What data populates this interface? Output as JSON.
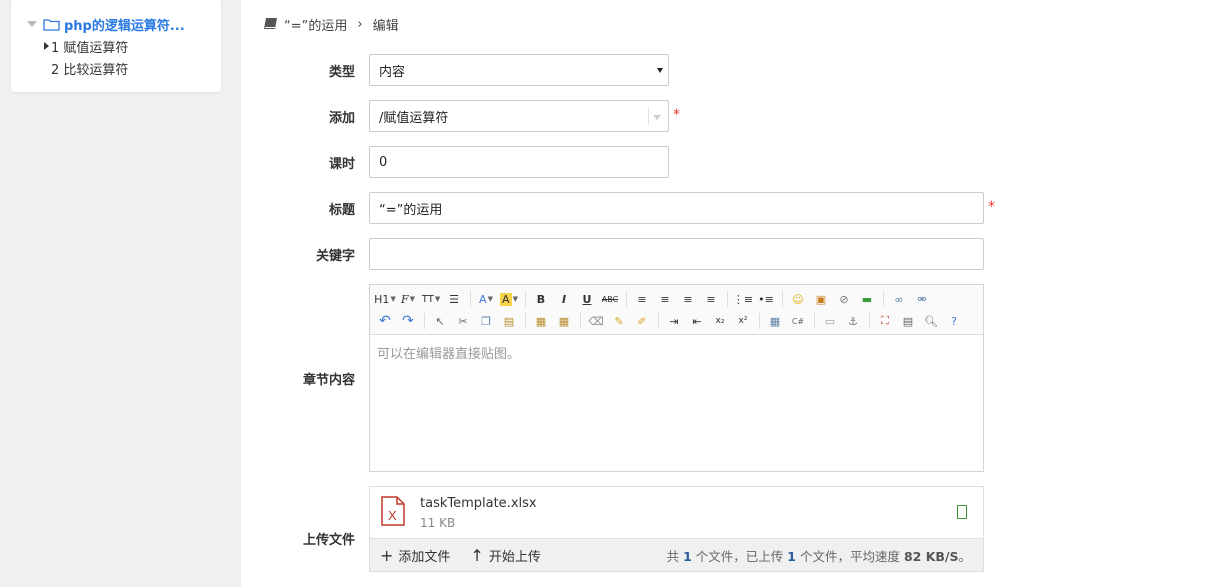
{
  "sidebar": {
    "root_label": "php的逻辑运算符...",
    "children": [
      {
        "label": "1 赋值运算符"
      },
      {
        "label": "2 比较运算符"
      }
    ]
  },
  "breadcrumb": {
    "parent": "“=”的运用",
    "current": "编辑"
  },
  "form": {
    "type": {
      "label": "类型",
      "value": "内容"
    },
    "add": {
      "label": "添加",
      "value": "/赋值运算符",
      "required": "*"
    },
    "hours": {
      "label": "课时",
      "value": "0"
    },
    "title": {
      "label": "标题",
      "value": "“=”的运用",
      "required": "*"
    },
    "keywords": {
      "label": "关键字",
      "value": ""
    },
    "content": {
      "label": "章节内容",
      "placeholder": "可以在编辑器直接贴图。"
    },
    "upload": {
      "label": "上传文件"
    }
  },
  "editor_toolbar": {
    "heading": "H1",
    "font_family": "F",
    "font_size": "TT"
  },
  "uploader": {
    "file_name": "taskTemplate.xlsx",
    "file_size": "11 KB",
    "add_file": "添加文件",
    "start_upload": "开始上传",
    "status_prefix": "共",
    "total_count": "1",
    "status_mid1": "个文件，已上传",
    "uploaded_count": "1",
    "status_mid2": "个文件，平均速度",
    "speed": "82 KB/S",
    "status_end": "。"
  },
  "colors": {
    "link_blue": "#2a7ae2",
    "required_red": "#ee3333",
    "excel_red": "#c0392b"
  }
}
